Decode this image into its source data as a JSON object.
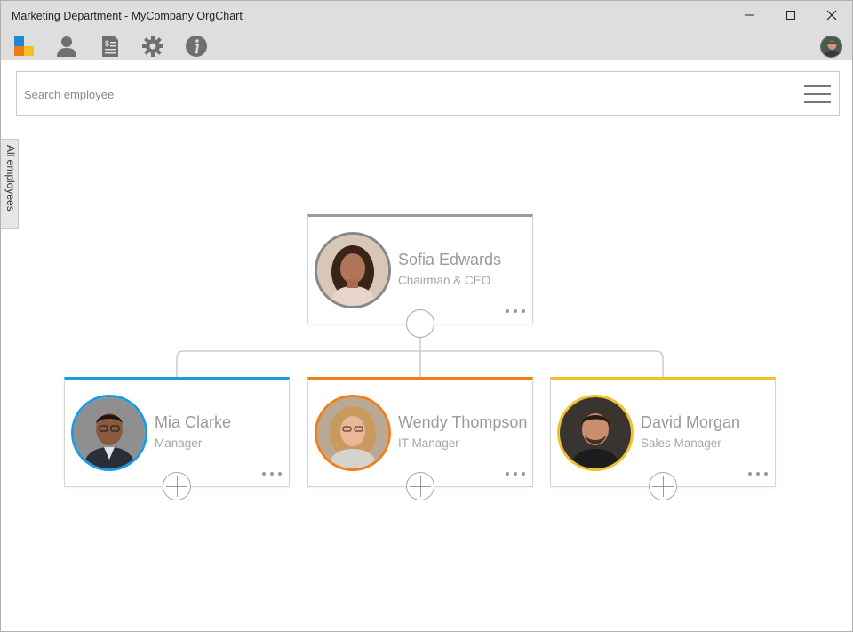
{
  "window": {
    "title": "Marketing Department - MyCompany OrgChart"
  },
  "toolbar": {
    "icons": [
      "app-logo-icon",
      "person-icon",
      "report-icon",
      "gear-icon",
      "info-icon"
    ]
  },
  "search": {
    "placeholder": "Search employee",
    "value": ""
  },
  "side_tab": {
    "label": "All employees"
  },
  "employees": [
    {
      "name": "Sofia Edwards",
      "title": "Chairman & CEO",
      "accent": "#9a9a9a",
      "expanded": true
    },
    {
      "name": "Mia Clarke",
      "title": "Manager",
      "accent": "#1e9be0",
      "expanded": false
    },
    {
      "name": "Wendy Thompson",
      "title": "IT Manager",
      "accent": "#ef7f1a",
      "expanded": false
    },
    {
      "name": "David Morgan",
      "title": "Sales Manager",
      "accent": "#f2c125",
      "expanded": false
    }
  ]
}
